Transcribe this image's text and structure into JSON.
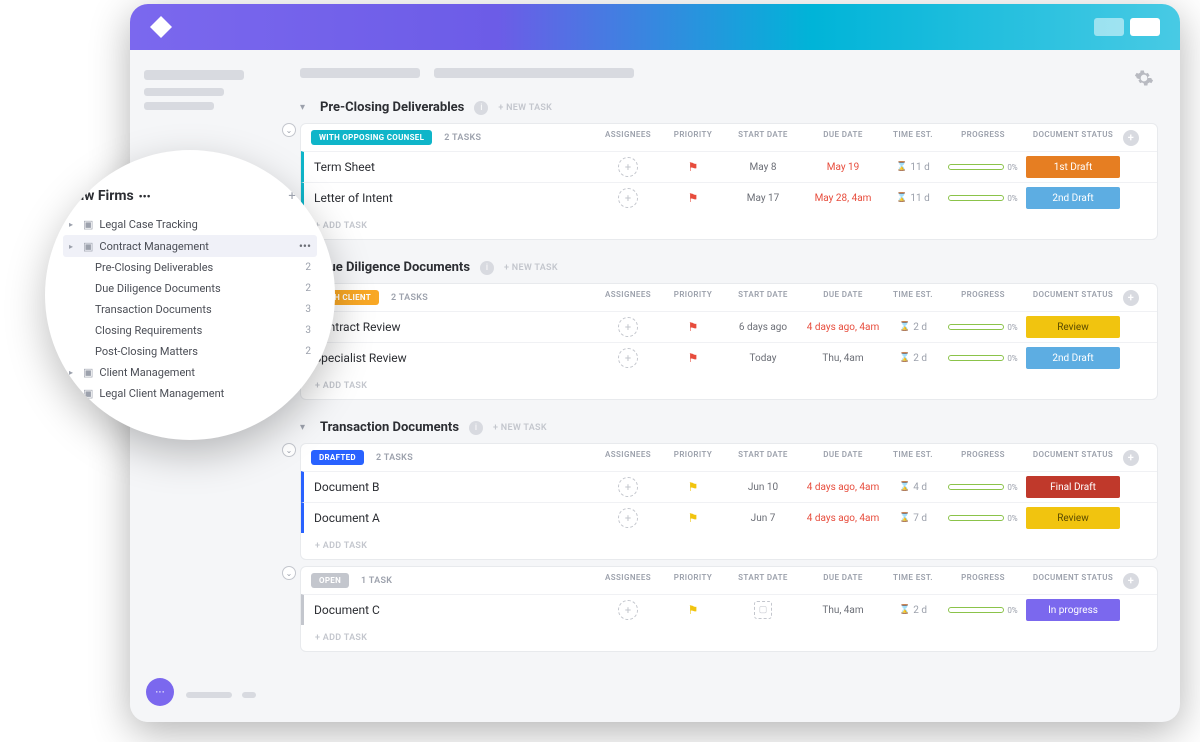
{
  "sidebar": {
    "title": "Law Firms",
    "items": [
      {
        "label": "Legal Case Tracking"
      },
      {
        "label": "Contract Management",
        "active": true
      },
      {
        "label": "Client Management"
      },
      {
        "label": "Legal Client Management"
      }
    ],
    "sub_items": [
      {
        "label": "Pre-Closing Deliverables",
        "count": "2"
      },
      {
        "label": "Due Diligence Documents",
        "count": "2"
      },
      {
        "label": "Transaction Documents",
        "count": "3"
      },
      {
        "label": "Closing Requirements",
        "count": "3"
      },
      {
        "label": "Post-Closing Matters",
        "count": "2"
      }
    ]
  },
  "columns": {
    "assignees": "ASSIGNEES",
    "priority": "PRIORITY",
    "start_date": "START DATE",
    "due_date": "DUE DATE",
    "time_est": "TIME EST.",
    "progress": "PROGRESS",
    "doc_status": "DOCUMENT STATUS"
  },
  "labels": {
    "new_task": "+ NEW TASK",
    "add_task": "+ ADD TASK",
    "tasks_2": "2 TASKS",
    "task_1": "1 TASK",
    "progress_pct": "0%"
  },
  "sections": [
    {
      "title": "Pre-Closing Deliverables",
      "groups": [
        {
          "status": "WITH OPPOSING COUNSEL",
          "badge_class": "badge-opposing",
          "row_class": "bl-opposing",
          "count": "2 TASKS",
          "tasks": [
            {
              "name": "Term Sheet",
              "flag": "red",
              "start": "May 8",
              "due": "May 19",
              "due_overdue": true,
              "time": "11 d",
              "doc": "1st Draft",
              "doc_class": "ds-1stdraft"
            },
            {
              "name": "Letter of Intent",
              "flag": "red",
              "start": "May 17",
              "due": "May 28, 4am",
              "due_overdue": true,
              "time": "11 d",
              "doc": "2nd Draft",
              "doc_class": "ds-2nddraft"
            }
          ]
        }
      ]
    },
    {
      "title": "Due Diligence Documents",
      "groups": [
        {
          "status": "WITH CLIENT",
          "badge_class": "badge-client",
          "row_class": "bl-client",
          "count": "2 TASKS",
          "tasks": [
            {
              "name": "Contract Review",
              "flag": "red",
              "start": "6 days ago",
              "due": "4 days ago, 4am",
              "due_overdue": true,
              "time": "2 d",
              "doc": "Review",
              "doc_class": "ds-review"
            },
            {
              "name": "Specialist Review",
              "flag": "red",
              "start": "Today",
              "due": "Thu, 4am",
              "time": "2 d",
              "doc": "2nd Draft",
              "doc_class": "ds-2nddraft"
            }
          ]
        }
      ]
    },
    {
      "title": "Transaction Documents",
      "groups": [
        {
          "status": "DRAFTED",
          "badge_class": "badge-drafted",
          "row_class": "bl-drafted",
          "count": "2 TASKS",
          "tasks": [
            {
              "name": "Document B",
              "flag": "yellow",
              "start": "Jun 10",
              "due": "4 days ago, 4am",
              "due_overdue": true,
              "time": "4 d",
              "doc": "Final Draft",
              "doc_class": "ds-finaldraft"
            },
            {
              "name": "Document A",
              "flag": "yellow",
              "start": "Jun 7",
              "due": "4 days ago, 4am",
              "due_overdue": true,
              "time": "7 d",
              "doc": "Review",
              "doc_class": "ds-review"
            }
          ]
        },
        {
          "status": "OPEN",
          "badge_class": "badge-open",
          "row_class": "bl-open",
          "count": "1 TASK",
          "tasks": [
            {
              "name": "Document C",
              "flag": "yellow",
              "start": "",
              "start_empty": true,
              "due": "Thu, 4am",
              "time": "2 d",
              "doc": "In progress",
              "doc_class": "ds-inprogress"
            }
          ]
        }
      ]
    }
  ]
}
